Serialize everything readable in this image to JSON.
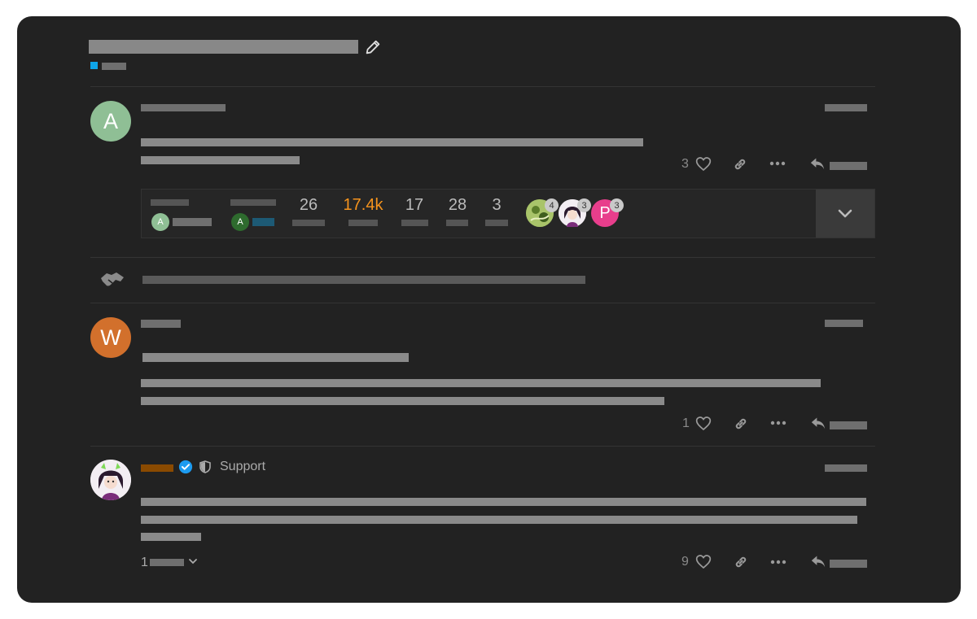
{
  "topic": {
    "title_redacted": true,
    "edit_icon": "pencil-icon",
    "category_color": "#0ea5e9"
  },
  "posts": [
    {
      "avatar_letter": "A",
      "avatar_color": "#8fbf95",
      "likes": "3",
      "icons": [
        "heart-icon",
        "link-icon",
        "more-icon",
        "reply-icon"
      ]
    },
    {
      "avatar_letter": "W",
      "avatar_color": "#d2702c",
      "likes": "1",
      "icons": [
        "heart-icon",
        "link-icon",
        "more-icon",
        "reply-icon"
      ]
    },
    {
      "avatar_letter": "",
      "role_label": "Support",
      "likes": "9",
      "replies_count": "1",
      "icons": [
        "heart-icon",
        "link-icon",
        "more-icon",
        "reply-icon"
      ]
    }
  ],
  "summary": {
    "created_avatar_letter": "A",
    "last_reply_avatar_letter": "A",
    "stats": [
      {
        "value": "26"
      },
      {
        "value": "17.4k",
        "hot": true
      },
      {
        "value": "17"
      },
      {
        "value": "28"
      },
      {
        "value": "3"
      }
    ],
    "participants": [
      {
        "badge": "4",
        "letter": ""
      },
      {
        "badge": "3",
        "letter": ""
      },
      {
        "badge": "3",
        "letter": "P",
        "color": "#e83e8c"
      }
    ],
    "expand_icon": "chevron-down-icon"
  },
  "small_action_icon": "handshake-icon"
}
